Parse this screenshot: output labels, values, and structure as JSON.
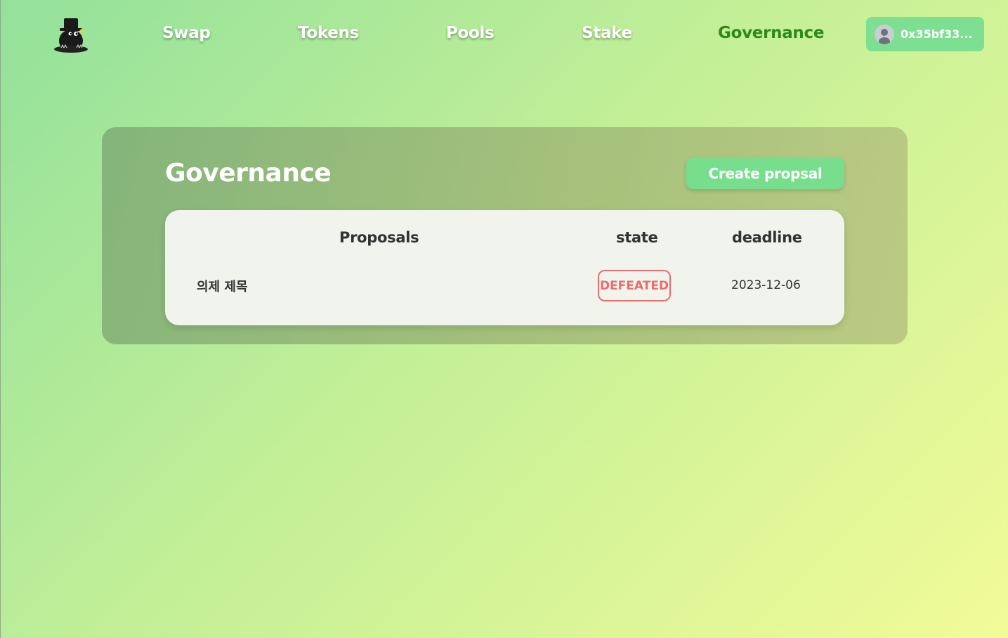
{
  "nav": {
    "items": [
      {
        "label": "Swap",
        "active": false
      },
      {
        "label": "Tokens",
        "active": false
      },
      {
        "label": "Pools",
        "active": false
      },
      {
        "label": "Stake",
        "active": false
      },
      {
        "label": "Governance",
        "active": true
      }
    ],
    "logo_icon": "mole-with-top-hat-logo",
    "wallet": {
      "address": "0x35bf33...",
      "avatar_icon": "user-avatar-icon"
    }
  },
  "governance": {
    "title": "Governance",
    "create_button": "Create propsal",
    "table": {
      "headers": {
        "proposals": "Proposals",
        "state": "state",
        "deadline": "deadline"
      },
      "rows": [
        {
          "title": "의제 제목",
          "state": "DEFEATED",
          "deadline": "2023-12-06"
        }
      ]
    }
  },
  "colors": {
    "accent": "#77de8e",
    "active_nav": "#2d8a1a",
    "defeated": "#ee6b6b",
    "panel": "#f0f4ec"
  }
}
